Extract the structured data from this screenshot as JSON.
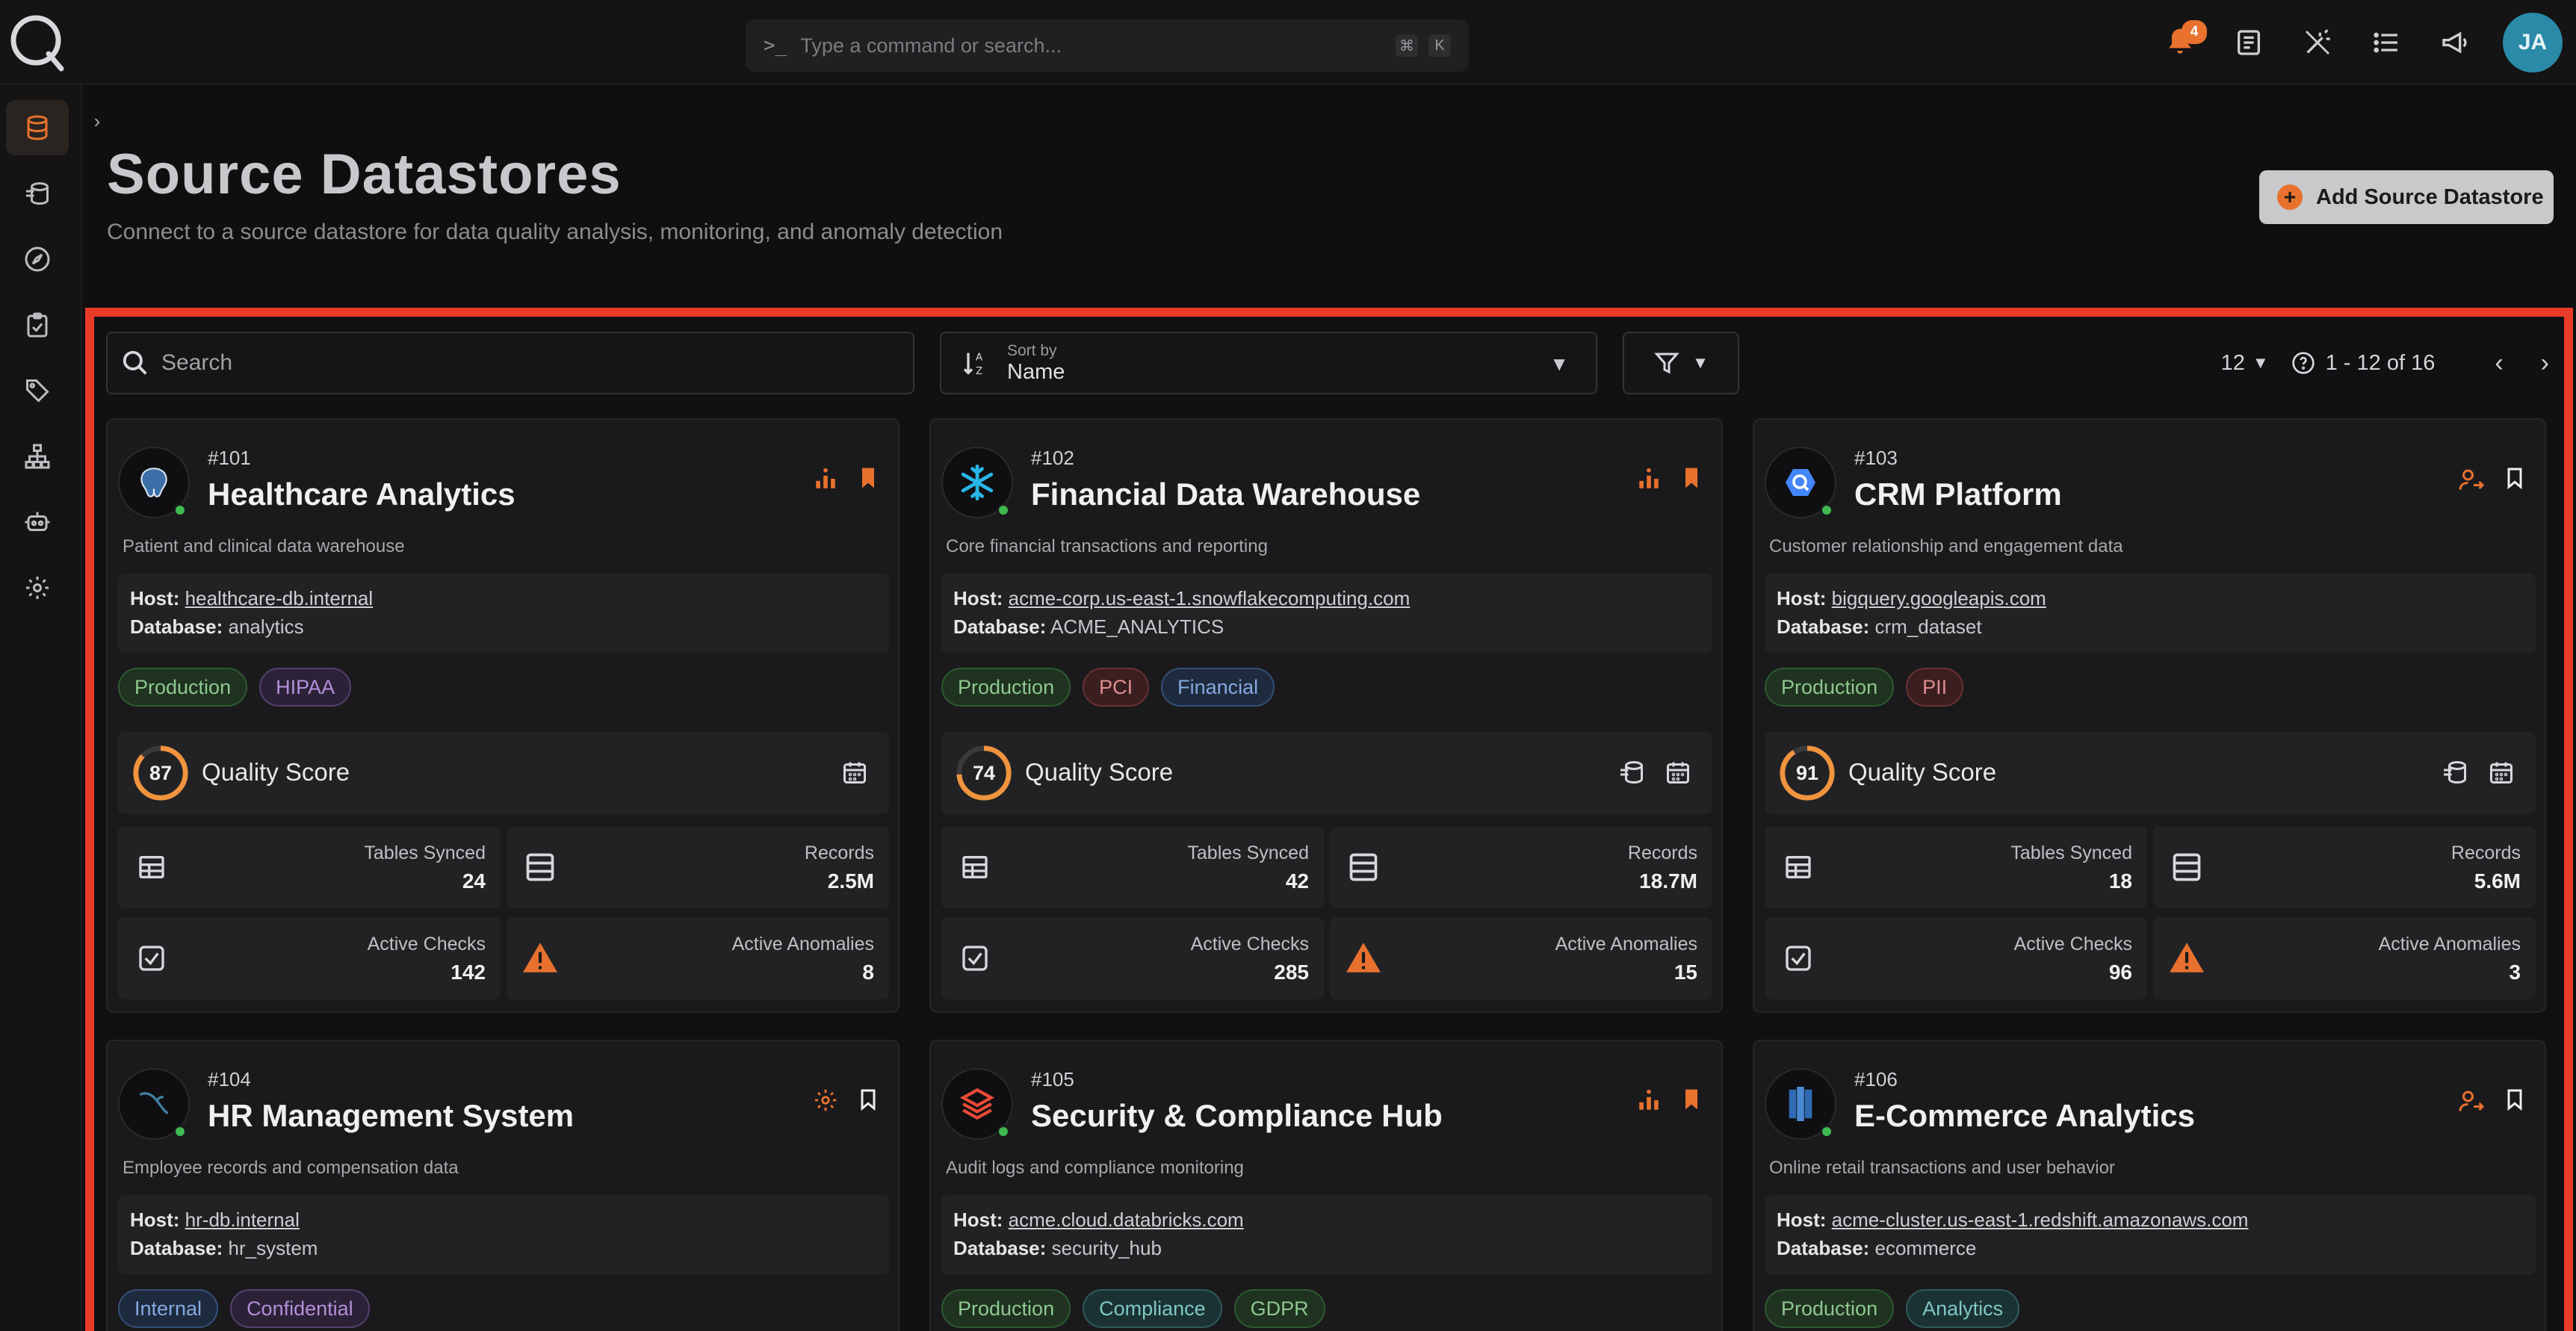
{
  "topbar": {
    "command_placeholder": "Type a command or search...",
    "shortcut_keys": [
      "⌘",
      "K"
    ],
    "notification_count": "4",
    "avatar_initials": "JA",
    "accent_color": "#e8712e"
  },
  "sidebar": {
    "items": [
      {
        "icon": "database-icon",
        "active": true
      },
      {
        "icon": "enrichment-icon"
      },
      {
        "icon": "compass-icon"
      },
      {
        "icon": "checklist-icon"
      },
      {
        "icon": "tag-icon"
      },
      {
        "icon": "hierarchy-icon"
      },
      {
        "icon": "robot-icon"
      },
      {
        "icon": "gear-icon"
      }
    ]
  },
  "header": {
    "title": "Source Datastores",
    "subtitle": "Connect to a source datastore for data quality analysis, monitoring, and anomaly detection",
    "add_button_label": "Add Source Datastore"
  },
  "toolbar": {
    "search_placeholder": "Search",
    "sort_label": "Sort by",
    "sort_value": "Name",
    "per_page": "12",
    "range": "1 - 12 of 16"
  },
  "labels": {
    "host": "Host:",
    "database": "Database:",
    "quality_score": "Quality Score",
    "tables_synced": "Tables Synced",
    "records": "Records",
    "active_checks": "Active Checks",
    "active_anomalies": "Active Anomalies"
  },
  "cards": [
    {
      "id": "#101",
      "name": "Healthcare Analytics",
      "description": "Patient and clinical data warehouse",
      "host": "healthcare-db.internal",
      "database": "analytics",
      "tags": [
        {
          "label": "Production",
          "color": "green"
        },
        {
          "label": "HIPAA",
          "color": "purple"
        }
      ],
      "quality": 87,
      "tables": "24",
      "records": "2.5M",
      "checks": "142",
      "anomalies": "8",
      "logo": "postgres-icon"
    },
    {
      "id": "#102",
      "name": "Financial Data Warehouse",
      "description": "Core financial transactions and reporting",
      "host": "acme-corp.us-east-1.snowflakecomputing.com",
      "database": "ACME_ANALYTICS",
      "tags": [
        {
          "label": "Production",
          "color": "green"
        },
        {
          "label": "PCI",
          "color": "red"
        },
        {
          "label": "Financial",
          "color": "blue"
        }
      ],
      "quality": 74,
      "tables": "42",
      "records": "18.7M",
      "checks": "285",
      "anomalies": "15",
      "logo": "snowflake-icon"
    },
    {
      "id": "#103",
      "name": "CRM Platform",
      "description": "Customer relationship and engagement data",
      "host": "bigquery.googleapis.com",
      "database": "crm_dataset",
      "tags": [
        {
          "label": "Production",
          "color": "green"
        },
        {
          "label": "PII",
          "color": "red"
        }
      ],
      "quality": 91,
      "tables": "18",
      "records": "5.6M",
      "checks": "96",
      "anomalies": "3",
      "logo": "bigquery-icon"
    },
    {
      "id": "#104",
      "name": "HR Management System",
      "description": "Employee records and compensation data",
      "host": "hr-db.internal",
      "database": "hr_system",
      "tags": [
        {
          "label": "Internal",
          "color": "blue"
        },
        {
          "label": "Confidential",
          "color": "purple"
        }
      ],
      "logo": "mysql-icon"
    },
    {
      "id": "#105",
      "name": "Security & Compliance Hub",
      "description": "Audit logs and compliance monitoring",
      "host": "acme.cloud.databricks.com",
      "database": "security_hub",
      "tags": [
        {
          "label": "Production",
          "color": "green"
        },
        {
          "label": "Compliance",
          "color": "teal"
        },
        {
          "label": "GDPR",
          "color": "green"
        }
      ],
      "logo": "databricks-icon"
    },
    {
      "id": "#106",
      "name": "E-Commerce Analytics",
      "description": "Online retail transactions and user behavior",
      "host": "acme-cluster.us-east-1.redshift.amazonaws.com",
      "database": "ecommerce",
      "tags": [
        {
          "label": "Production",
          "color": "green"
        },
        {
          "label": "Analytics",
          "color": "teal"
        }
      ],
      "logo": "redshift-icon"
    }
  ]
}
